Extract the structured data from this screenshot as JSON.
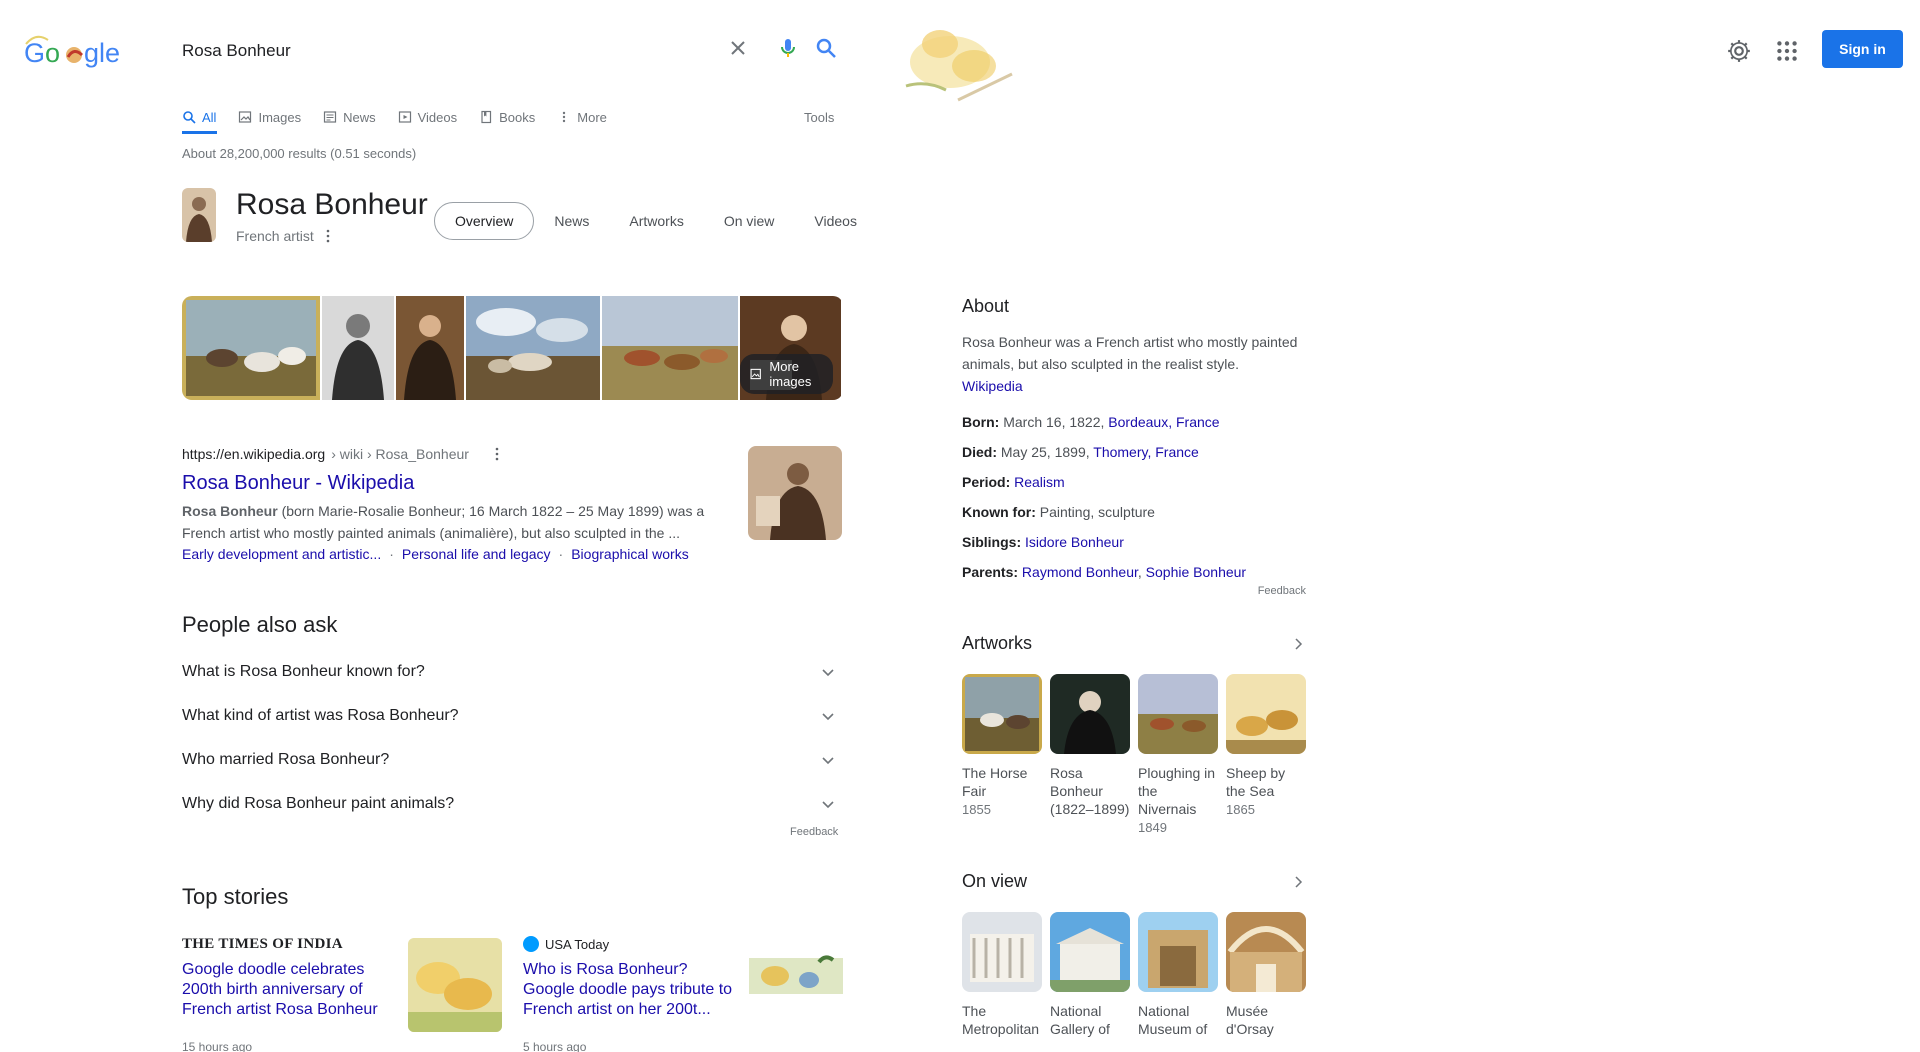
{
  "search": {
    "query": "Rosa Bonheur"
  },
  "header": {
    "signin_label": "Sign in"
  },
  "tabs": [
    {
      "label": "All",
      "icon": "search-icon",
      "active": true
    },
    {
      "label": "Images",
      "icon": "image-icon"
    },
    {
      "label": "News",
      "icon": "news-icon"
    },
    {
      "label": "Videos",
      "icon": "play-icon"
    },
    {
      "label": "Books",
      "icon": "book-icon"
    },
    {
      "label": "More",
      "icon": "more-vert-icon"
    }
  ],
  "tools_label": "Tools",
  "result_stats": "About 28,200,000 results (0.51 seconds)",
  "entity": {
    "title": "Rosa Bonheur",
    "subtitle": "French artist",
    "tabs": [
      "Overview",
      "News",
      "Artworks",
      "On view",
      "Videos"
    ],
    "more_images_label": "More images"
  },
  "wiki_result": {
    "domain": "https://en.wikipedia.org",
    "path": "› wiki › Rosa_Bonheur",
    "title": "Rosa Bonheur - Wikipedia",
    "snippet_bold": "Rosa Bonheur",
    "snippet_line1": " (born Marie-Rosalie Bonheur; 16 March 1822 – 25 May 1899) was a",
    "snippet_line2": "French artist who mostly painted animals (animalière), but also sculpted in the ...",
    "sitelinks": [
      "Early development and artistic...",
      "Personal life and legacy",
      "Biographical works"
    ],
    "sitelink_separator": "·"
  },
  "people_also_ask": {
    "title": "People also ask",
    "questions": [
      "What is Rosa Bonheur known for?",
      "What kind of artist was Rosa Bonheur?",
      "Who married Rosa Bonheur?",
      "Why did Rosa Bonheur paint animals?"
    ],
    "feedback": "Feedback"
  },
  "top_stories": {
    "title": "Top stories",
    "stories": [
      {
        "source": "THE TIMES OF INDIA",
        "headline": "Google doodle celebrates 200th birth anniversary of French artist Rosa Bonheur",
        "time": "15 hours ago"
      },
      {
        "source": "USA Today",
        "headline": "Who is Rosa Bonheur? Google doodle pays tribute to French artist on her 200t...",
        "time": "5 hours ago"
      }
    ]
  },
  "knowledge_panel": {
    "about_title": "About",
    "description": "Rosa Bonheur was a French artist who mostly painted animals, but also sculpted in the realist style.",
    "description_source": "Wikipedia",
    "facts": {
      "born_label": "Born:",
      "born_date": "March 16, 1822, ",
      "born_place": "Bordeaux, France",
      "died_label": "Died:",
      "died_date": "May 25, 1899, ",
      "died_place": "Thomery, France",
      "period_label": "Period:",
      "period_value": "Realism",
      "known_label": "Known for:",
      "known_value": "Painting, sculpture",
      "siblings_label": "Siblings:",
      "siblings_value": "Isidore Bonheur",
      "parents_label": "Parents:",
      "parent_1": "Raymond Bonheur",
      "parents_sep": ", ",
      "parent_2": "Sophie Bonheur"
    },
    "feedback": "Feedback",
    "artworks_title": "Artworks",
    "artworks": [
      {
        "name": "The Horse Fair",
        "year": "1855"
      },
      {
        "name": "Rosa Bonheur (1822–1899)",
        "year": ""
      },
      {
        "name": "Ploughing in the Nivernais",
        "year": "1849"
      },
      {
        "name": "Sheep by the Sea",
        "year": "1865"
      }
    ],
    "onview_title": "On view",
    "onview": [
      {
        "name": "The Metropolitan"
      },
      {
        "name": "National Gallery of"
      },
      {
        "name": "National Museum of"
      },
      {
        "name": "Musée d'Orsay"
      }
    ]
  },
  "colors": {
    "accent": "#1a73e8",
    "link": "#1a0dab",
    "muted": "#70757a"
  }
}
